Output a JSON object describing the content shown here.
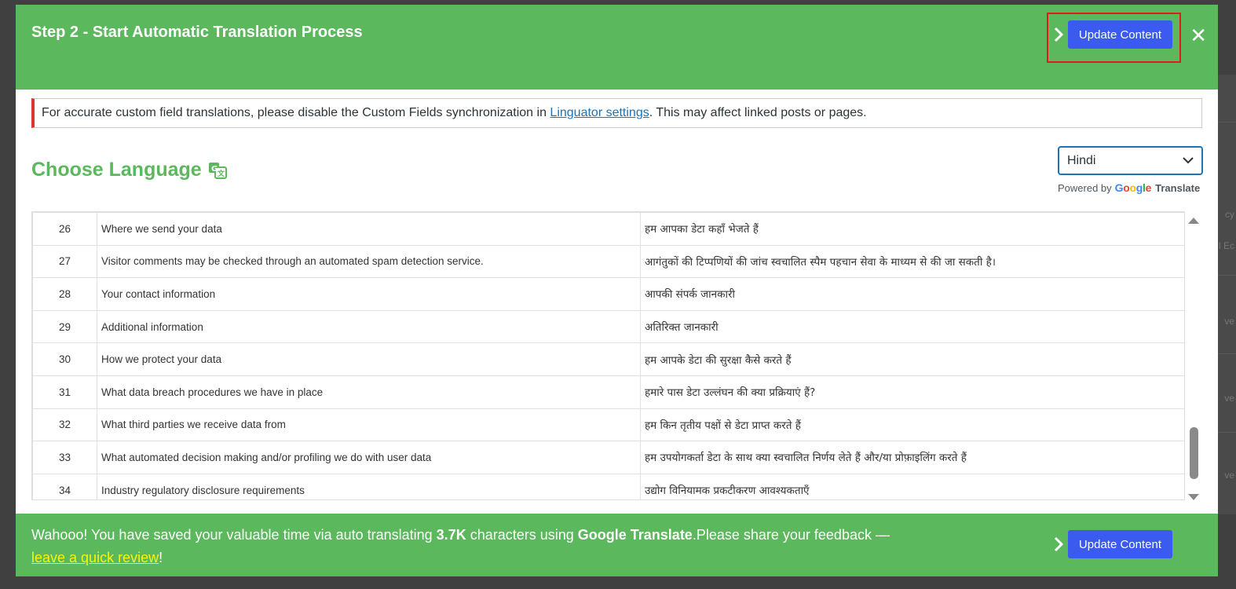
{
  "modal": {
    "title": "Step 2 - Start Automatic Translation Process",
    "update_button": "Update Content",
    "close_symbol": "✕"
  },
  "notice": {
    "text_before": "For accurate custom field translations, please disable the Custom Fields synchronization in ",
    "link_text": "Linguator settings",
    "text_after": ". This may affect linked posts or pages."
  },
  "language": {
    "heading": "Choose Language",
    "selected": "Hindi",
    "powered_by": "Powered by",
    "google_letters": [
      "G",
      "o",
      "o",
      "g",
      "l",
      "e"
    ],
    "translate_label": "Translate"
  },
  "table": {
    "rows": [
      {
        "num": "26",
        "source": "Where we send your data",
        "target": "हम आपका डेटा कहाँ भेजते हैं"
      },
      {
        "num": "27",
        "source": "Visitor comments may be checked through an automated spam detection service.",
        "target": "आगंतुकों की टिप्पणियों की जांच स्वचालित स्पैम पहचान सेवा के माध्यम से की जा सकती है।"
      },
      {
        "num": "28",
        "source": "Your contact information",
        "target": "आपकी संपर्क जानकारी"
      },
      {
        "num": "29",
        "source": "Additional information",
        "target": "अतिरिक्त जानकारी"
      },
      {
        "num": "30",
        "source": "How we protect your data",
        "target": "हम आपके डेटा की सुरक्षा कैसे करते हैं"
      },
      {
        "num": "31",
        "source": "What data breach procedures we have in place",
        "target": "हमारे पास डेटा उल्लंघन की क्या प्रक्रियाएं हैं?"
      },
      {
        "num": "32",
        "source": "What third parties we receive data from",
        "target": "हम किन तृतीय पक्षों से डेटा प्राप्त करते हैं"
      },
      {
        "num": "33",
        "source": "What automated decision making and/or profiling we do with user data",
        "target": "हम उपयोगकर्ता डेटा के साथ क्या स्वचालित निर्णय लेते हैं और/या प्रोफ़ाइलिंग करते हैं"
      },
      {
        "num": "34",
        "source": "Industry regulatory disclosure requirements",
        "target": "उद्योग विनियामक प्रकटीकरण आवश्यकताएँ"
      }
    ]
  },
  "footer": {
    "text_1": "Wahooo! You have saved your valuable time via auto translating ",
    "char_count": "3.7K",
    "text_2": " characters using ",
    "service": "Google Translate",
    "text_3": ".Please share your feedback —",
    "review_link": "leave a quick review",
    "text_4": "!",
    "update_button": "Update Content"
  },
  "backdrop": {
    "fragments": [
      "cy",
      "l Ec",
      "ve",
      "ve",
      "ve"
    ]
  },
  "colors": {
    "header_green": "#5cb85c",
    "primary_button": "#3a5af0",
    "highlight_red": "#e11b1b",
    "link_yellow": "#f4f50a",
    "notice_border": "#d63638"
  }
}
